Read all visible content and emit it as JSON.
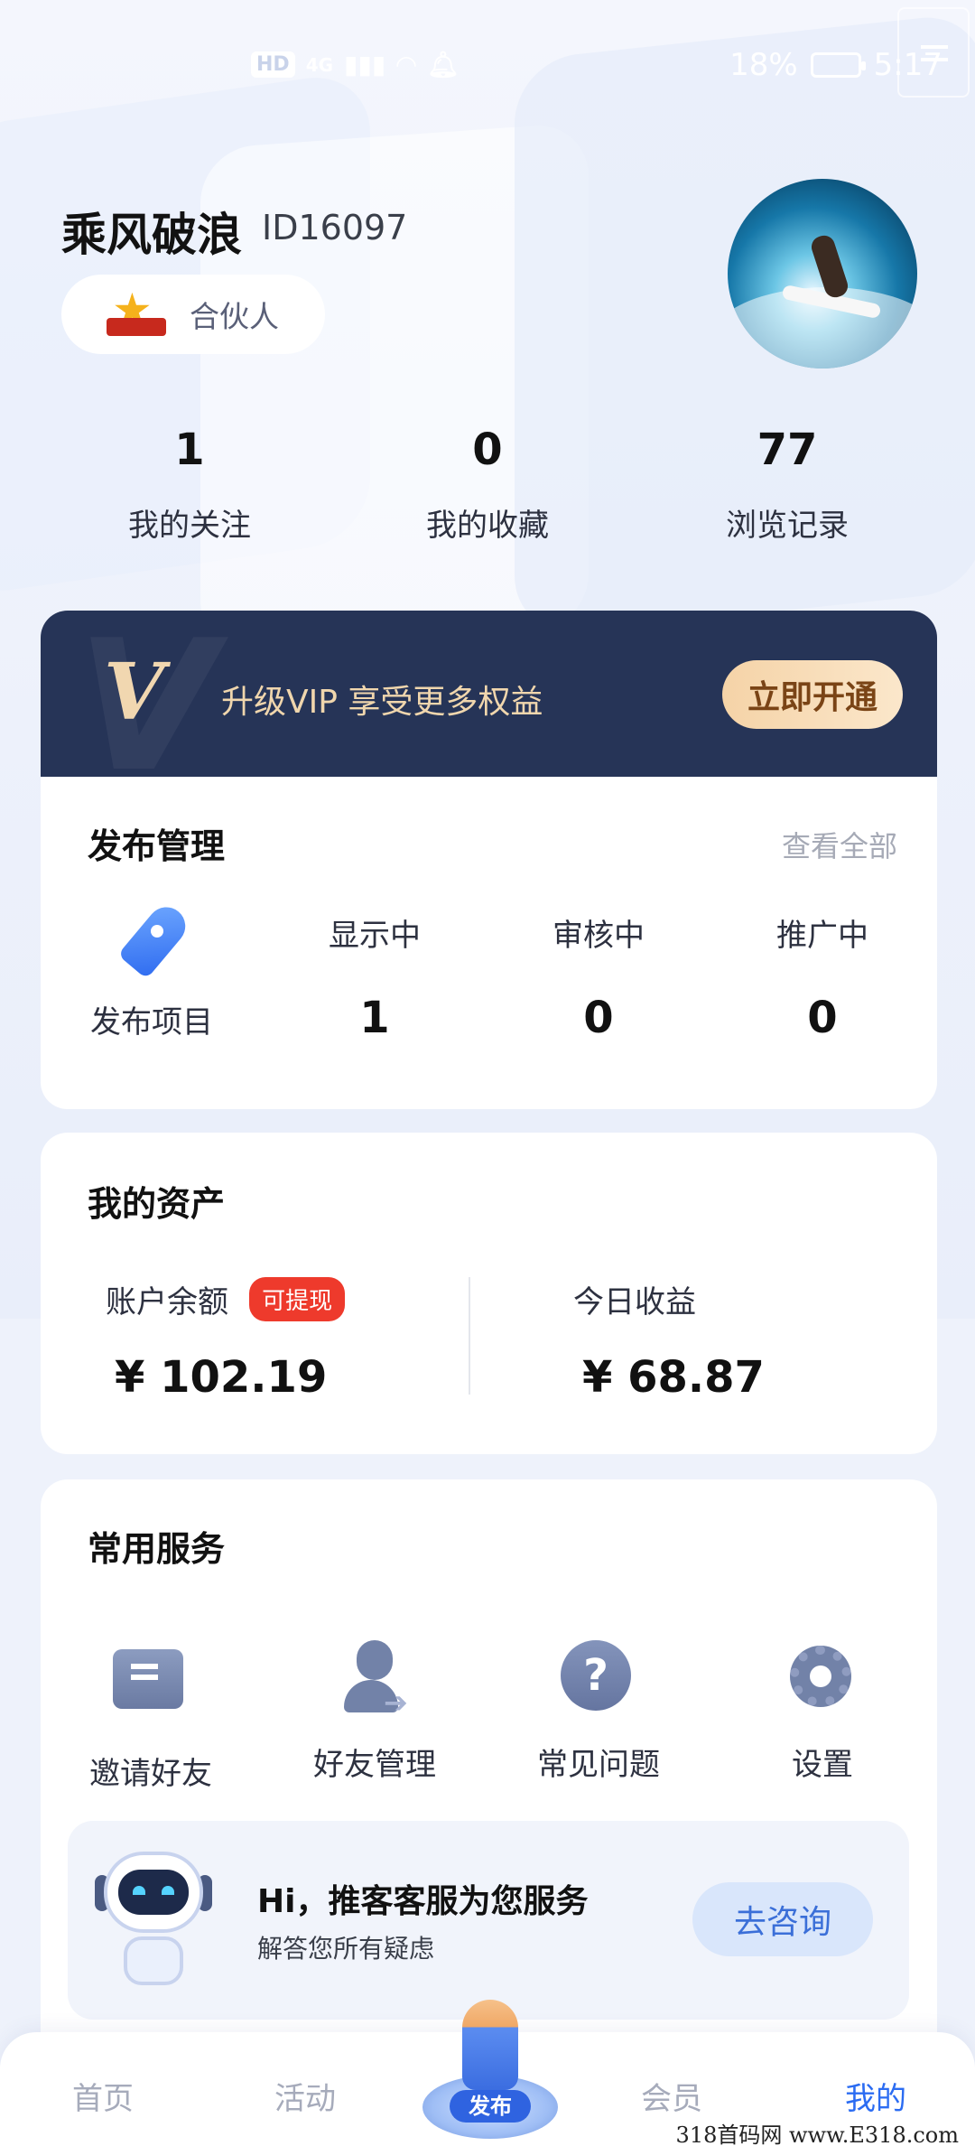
{
  "status_bar": {
    "left_badges": [
      "HD",
      "4G"
    ],
    "battery": "18%",
    "time": "5:17"
  },
  "profile": {
    "username": "乘风破浪",
    "user_id": "ID16097",
    "role": "合伙人",
    "role_icon": "partner-star-icon",
    "avatar": "surfer-avatar"
  },
  "stats": [
    {
      "value": "1",
      "label": "我的关注"
    },
    {
      "value": "0",
      "label": "我的收藏"
    },
    {
      "value": "77",
      "label": "浏览记录"
    }
  ],
  "vip": {
    "logo": "V",
    "text": "升级VIP 享受更多权益",
    "button": "立即开通"
  },
  "publish": {
    "title": "发布管理",
    "view_all": "查看全部",
    "action_label": "发布项目",
    "stats": [
      {
        "label": "显示中",
        "value": "1"
      },
      {
        "label": "审核中",
        "value": "0"
      },
      {
        "label": "推广中",
        "value": "0"
      }
    ]
  },
  "assets": {
    "title": "我的资产",
    "balance_label": "账户余额",
    "balance_badge": "可提现",
    "balance": "¥ 102.19",
    "today_label": "今日收益",
    "today": "¥ 68.87"
  },
  "services": {
    "title": "常用服务",
    "items": [
      {
        "label": "邀请好友",
        "icon": "invite-mail-icon"
      },
      {
        "label": "好友管理",
        "icon": "friend-manage-icon"
      },
      {
        "label": "常见问题",
        "icon": "question-icon"
      },
      {
        "label": "设置",
        "icon": "gear-icon"
      }
    ],
    "support": {
      "title": "Hi，推客客服为您服务",
      "subtitle": "解答您所有疑虑",
      "button": "去咨询"
    }
  },
  "tabbar": {
    "tabs": [
      "首页",
      "活动",
      "发布",
      "会员",
      "我的"
    ],
    "active": "我的"
  },
  "watermark": "318首码网 www.E318.com",
  "colors": {
    "accent": "#2b6cf2",
    "vip_bg": "#263457",
    "vip_gold": "#f0d6ad",
    "badge_red": "#ee3a2c"
  }
}
